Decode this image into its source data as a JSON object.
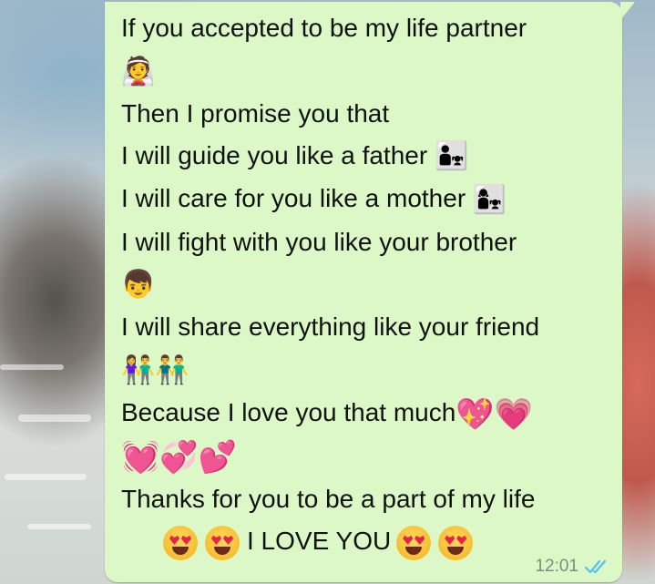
{
  "message": {
    "lines": [
      {
        "text": "If you accepted to be my life partner",
        "emoji": ""
      },
      {
        "text": "",
        "emoji": "👰"
      },
      {
        "text": "Then I promise you that",
        "emoji": ""
      },
      {
        "text": "I will guide you like a father ",
        "emoji": "👨‍👧"
      },
      {
        "text": "I will care for you like a mother ",
        "emoji": "👩‍👧"
      },
      {
        "text": "I will fight with you like your brother",
        "emoji": ""
      },
      {
        "text": "",
        "emoji": "👦"
      },
      {
        "text": "I will share everything like your friend",
        "emoji": ""
      },
      {
        "text": "",
        "emoji": "👫👬"
      },
      {
        "text": "Because I love you that much",
        "emoji": "💖💗"
      },
      {
        "text": "",
        "emoji": "💓💞💕"
      },
      {
        "text": "Thanks for you to be a part of my life",
        "emoji": ""
      }
    ],
    "closing": "I LOVE YOU",
    "closing_emoji_count_before": 2,
    "closing_emoji_count_after": 2,
    "closing_emoji": "heart-eyes-face"
  },
  "status": {
    "time": "12:01",
    "read_receipt": "double-check-blue",
    "tick_color": "#4fc3f7"
  },
  "colors": {
    "bubble": "#dcf8c6",
    "text": "#111111",
    "meta_text": "#7f8c80"
  }
}
